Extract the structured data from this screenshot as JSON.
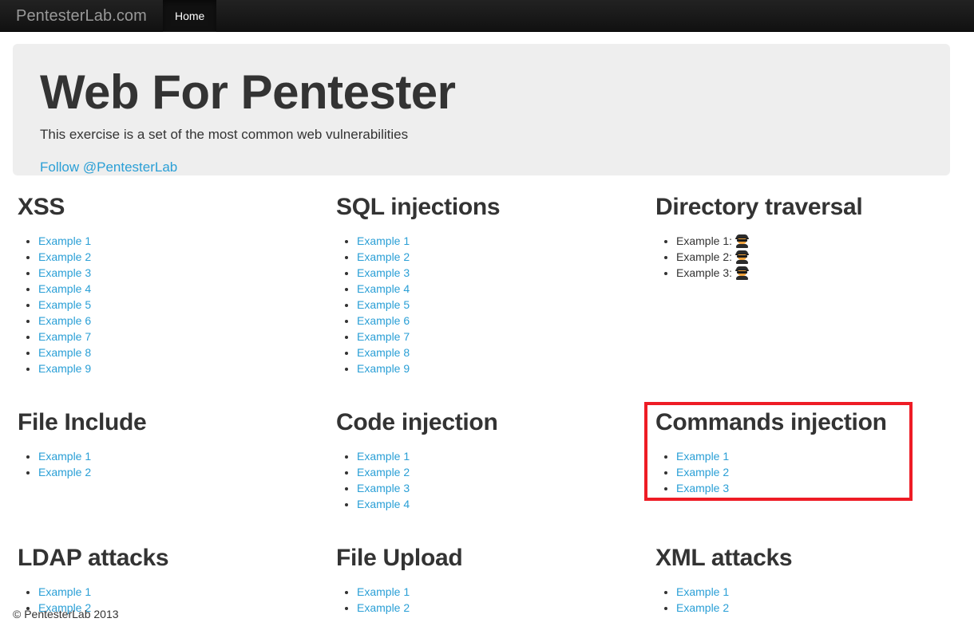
{
  "navbar": {
    "brand": "PentesterLab.com",
    "tabs": [
      {
        "label": "Home",
        "active": true
      }
    ]
  },
  "jumbotron": {
    "title": "Web For Pentester",
    "subtitle": "This exercise is a set of the most common web vulnerabilities",
    "follow_link": "Follow @PentesterLab"
  },
  "sections": {
    "xss": {
      "title": "XSS",
      "items": [
        "Example 1",
        "Example 2",
        "Example 3",
        "Example 4",
        "Example 5",
        "Example 6",
        "Example 7",
        "Example 8",
        "Example 9"
      ]
    },
    "sql_injections": {
      "title": "SQL injections",
      "items": [
        "Example 1",
        "Example 2",
        "Example 3",
        "Example 4",
        "Example 5",
        "Example 6",
        "Example 7",
        "Example 8",
        "Example 9"
      ]
    },
    "directory_traversal": {
      "title": "Directory traversal",
      "items": [
        "Example 1:",
        "Example 2:",
        "Example 3:"
      ],
      "item_icon": "spy-emoji"
    },
    "file_include": {
      "title": "File Include",
      "items": [
        "Example 1",
        "Example 2"
      ]
    },
    "code_injection": {
      "title": "Code injection",
      "items": [
        "Example 1",
        "Example 2",
        "Example 3",
        "Example 4"
      ]
    },
    "commands_injection": {
      "title": "Commands injection",
      "items": [
        "Example 1",
        "Example 2",
        "Example 3"
      ],
      "highlighted": true,
      "highlight_color": "#ee1c25"
    },
    "ldap_attacks": {
      "title": "LDAP attacks",
      "items": [
        "Example 1",
        "Example 2"
      ]
    },
    "file_upload": {
      "title": "File Upload",
      "items": [
        "Example 1",
        "Example 2"
      ]
    },
    "xml_attacks": {
      "title": "XML attacks",
      "items": [
        "Example 1",
        "Example 2"
      ]
    }
  },
  "footer": {
    "copyright": "© PentesterLab 2013"
  },
  "colors": {
    "link": "#2a9fd6",
    "navbar_bg": "#111111",
    "jumbotron_bg": "#eeeeee",
    "text": "#333333",
    "annotation": "#ee1c25"
  }
}
